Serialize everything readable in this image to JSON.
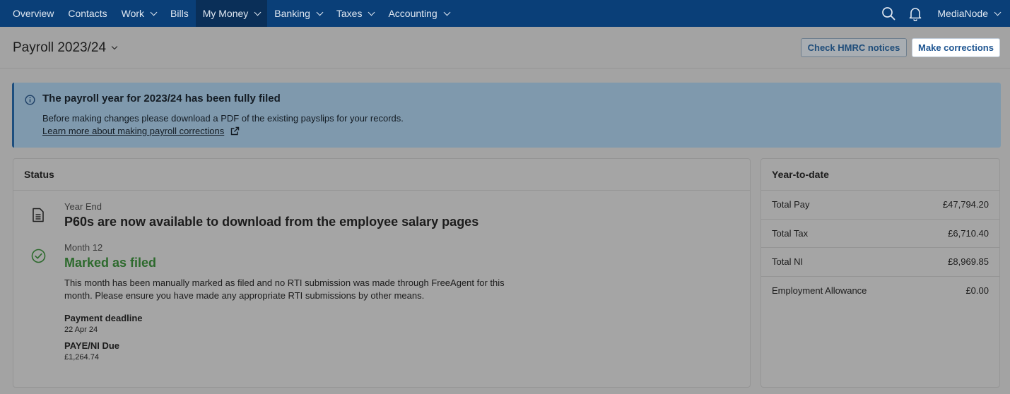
{
  "nav": {
    "items": [
      {
        "label": "Overview",
        "dropdown": false
      },
      {
        "label": "Contacts",
        "dropdown": false
      },
      {
        "label": "Work",
        "dropdown": true
      },
      {
        "label": "Bills",
        "dropdown": false
      },
      {
        "label": "My Money",
        "dropdown": true,
        "active": true
      },
      {
        "label": "Banking",
        "dropdown": true
      },
      {
        "label": "Taxes",
        "dropdown": true
      },
      {
        "label": "Accounting",
        "dropdown": true
      }
    ],
    "search_icon": "search-icon",
    "notifications_icon": "bell-icon",
    "user_label": "MediaNode"
  },
  "header": {
    "title": "Payroll 2023/24",
    "check_hmrc_label": "Check HMRC notices",
    "make_corrections_label": "Make corrections"
  },
  "banner": {
    "icon": "info-icon",
    "title": "The payroll year for 2023/24 has been fully filed",
    "text": "Before making changes please download a PDF of the existing payslips for your records.",
    "link_label": "Learn more about making payroll corrections",
    "link_icon": "external-link-icon"
  },
  "status": {
    "title": "Status",
    "year_end": {
      "icon": "document-icon",
      "label": "Year End",
      "heading": "P60s are now available to download from the employee salary pages"
    },
    "month": {
      "icon": "check-circle-icon",
      "label": "Month 12",
      "heading": "Marked as filed",
      "description": "This month has been manually marked as filed and no RTI submission was made through FreeAgent for this month. Please ensure you have made any appropriate RTI submissions by other means.",
      "payment_deadline_label": "Payment deadline",
      "payment_deadline_value": "22 Apr 24",
      "paye_label": "PAYE/NI Due",
      "paye_value": "£1,264.74"
    }
  },
  "ytd": {
    "title": "Year-to-date",
    "rows": [
      {
        "label": "Total Pay",
        "value": "£47,794.20"
      },
      {
        "label": "Total Tax",
        "value": "£6,710.40"
      },
      {
        "label": "Total NI",
        "value": "£8,969.85"
      },
      {
        "label": "Employment Allowance",
        "value": "£0.00"
      }
    ]
  },
  "colors": {
    "nav_bg": "#0a3f78",
    "banner_bg": "#7f99ad",
    "accent_green": "#2d6a2d",
    "link_blue": "#1e5591"
  }
}
